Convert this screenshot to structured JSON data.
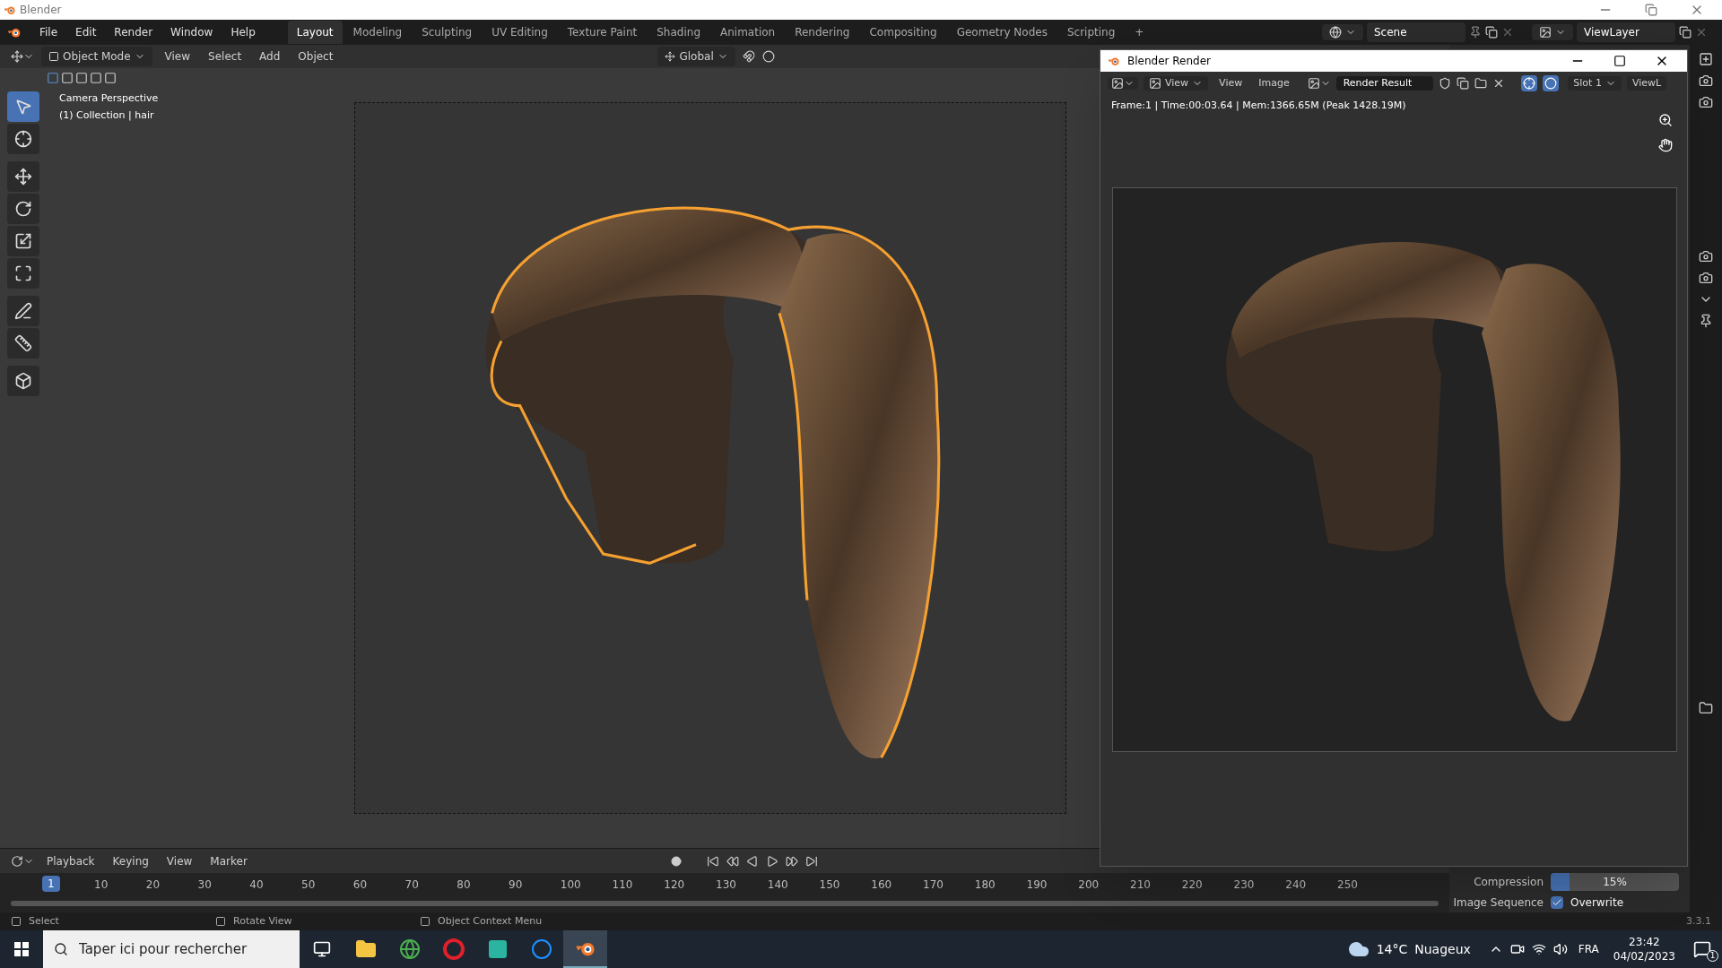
{
  "window": {
    "title": "Blender"
  },
  "menu": [
    "File",
    "Edit",
    "Render",
    "Window",
    "Help"
  ],
  "workspaces": [
    {
      "label": "Layout",
      "selected": true
    },
    {
      "label": "Modeling",
      "selected": false
    },
    {
      "label": "Sculpting",
      "selected": false
    },
    {
      "label": "UV Editing",
      "selected": false
    },
    {
      "label": "Texture Paint",
      "selected": false
    },
    {
      "label": "Shading",
      "selected": false
    },
    {
      "label": "Animation",
      "selected": false
    },
    {
      "label": "Rendering",
      "selected": false
    },
    {
      "label": "Compositing",
      "selected": false
    },
    {
      "label": "Geometry Nodes",
      "selected": false
    },
    {
      "label": "Scripting",
      "selected": false
    },
    {
      "label": "+",
      "selected": false
    }
  ],
  "scene": {
    "name": "Scene"
  },
  "view_layer": {
    "name": "ViewLayer"
  },
  "viewport": {
    "mode": "Object Mode",
    "menus": [
      "View",
      "Select",
      "Add",
      "Object"
    ],
    "orientation": "Global",
    "overlay_lines": [
      "Camera Perspective",
      "(1) Collection | hair"
    ],
    "tools": [
      {
        "kind": "select",
        "selected": true
      },
      {
        "kind": "cursor",
        "selected": false
      },
      {
        "kind": "move",
        "selected": false
      },
      {
        "kind": "rotate",
        "selected": false
      },
      {
        "kind": "scale",
        "selected": false
      },
      {
        "kind": "transform",
        "selected": false
      },
      {
        "kind": "annotate",
        "selected": false
      },
      {
        "kind": "measure",
        "selected": false
      },
      {
        "kind": "add-cube",
        "selected": false
      }
    ]
  },
  "render_window": {
    "title": "Blender Render",
    "menus": [
      {
        "label": "View",
        "kind": "dropdown"
      },
      {
        "label": "View",
        "kind": "menu"
      },
      {
        "label": "Image",
        "kind": "menu"
      }
    ],
    "image_name": "Render Result",
    "slot": "Slot 1",
    "view_layer": "ViewL",
    "info": "Frame:1 | Time:00:03.64 | Mem:1366.65M (Peak 1428.19M)"
  },
  "properties": {
    "compression": {
      "label": "Compression",
      "value": "15%",
      "level": 0.15
    },
    "image_sequence": {
      "label": "Image Sequence",
      "option": "Overwrite",
      "checked": true
    }
  },
  "timeline": {
    "menus": [
      "Playback",
      "Keying",
      "View",
      "Marker"
    ],
    "current_frame": "1",
    "ticks": [
      "10",
      "20",
      "30",
      "40",
      "50",
      "60",
      "70",
      "80",
      "90",
      "100",
      "110",
      "120",
      "130",
      "140",
      "150",
      "160",
      "170",
      "180",
      "190",
      "200",
      "210",
      "220",
      "230",
      "240",
      "250"
    ]
  },
  "status_bar": {
    "hints": [
      "Select",
      "Rotate View",
      "Object Context Menu"
    ],
    "version": "3.3.1"
  },
  "taskbar": {
    "search_placeholder": "Taper ici pour rechercher",
    "apps": [
      {
        "kind": "task-view",
        "selected": false
      },
      {
        "kind": "folder",
        "selected": false
      },
      {
        "kind": "globe",
        "selected": false
      },
      {
        "kind": "ring",
        "selected": false
      },
      {
        "kind": "letter-tile",
        "selected": false
      },
      {
        "kind": "c-circle",
        "selected": false
      },
      {
        "kind": "blender",
        "selected": true
      }
    ],
    "temperature": "14°C",
    "condition": "Nuageux",
    "language": "FRA",
    "time": "23:42",
    "date": "04/02/2023",
    "notifications": "1"
  }
}
